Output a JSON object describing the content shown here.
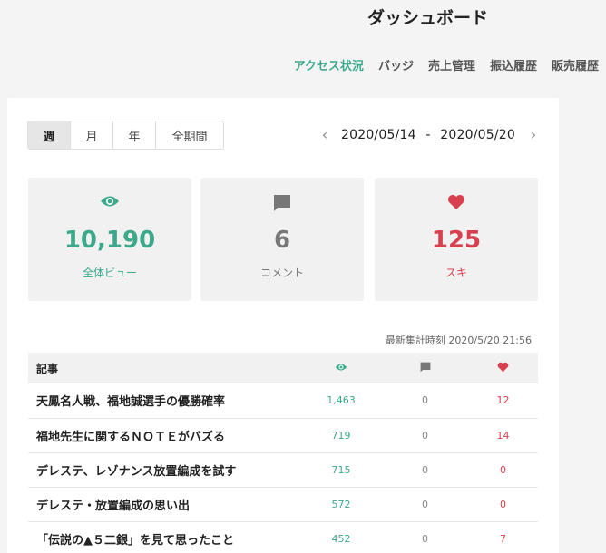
{
  "header": {
    "title": "ダッシュボード"
  },
  "nav": [
    "アクセス状況",
    "バッジ",
    "売上管理",
    "振込履歴",
    "販売履歴"
  ],
  "tabs": [
    "週",
    "月",
    "年",
    "全期間"
  ],
  "date_range": {
    "start": "2020/05/14",
    "separator": "-",
    "end": "2020/05/20"
  },
  "stats": {
    "views": {
      "value": "10,190",
      "label": "全体ビュー",
      "icon": "eye-icon"
    },
    "comments": {
      "value": "6",
      "label": "コメント",
      "icon": "comment-icon"
    },
    "likes": {
      "value": "125",
      "label": "スキ",
      "icon": "heart-icon"
    }
  },
  "updated_label": "最新集計時刻 2020/5/20 21:56",
  "table": {
    "header_article": "記事",
    "rows": [
      {
        "title": "天鳳名人戦、福地誠選手の優勝確率",
        "views": "1,463",
        "comments": "0",
        "likes": "12"
      },
      {
        "title": "福地先生に関するＮＯＴＥがバズる",
        "views": "719",
        "comments": "0",
        "likes": "14"
      },
      {
        "title": "デレステ、レゾナンス放置編成を試す",
        "views": "715",
        "comments": "0",
        "likes": "0"
      },
      {
        "title": "デレステ・放置編成の思い出",
        "views": "572",
        "comments": "0",
        "likes": "0"
      },
      {
        "title": "「伝説の▲５二銀」を見て思ったこと",
        "views": "452",
        "comments": "0",
        "likes": "7"
      }
    ]
  },
  "colors": {
    "accent": "#3ca98b",
    "like": "#d9404f",
    "muted": "#777777"
  }
}
